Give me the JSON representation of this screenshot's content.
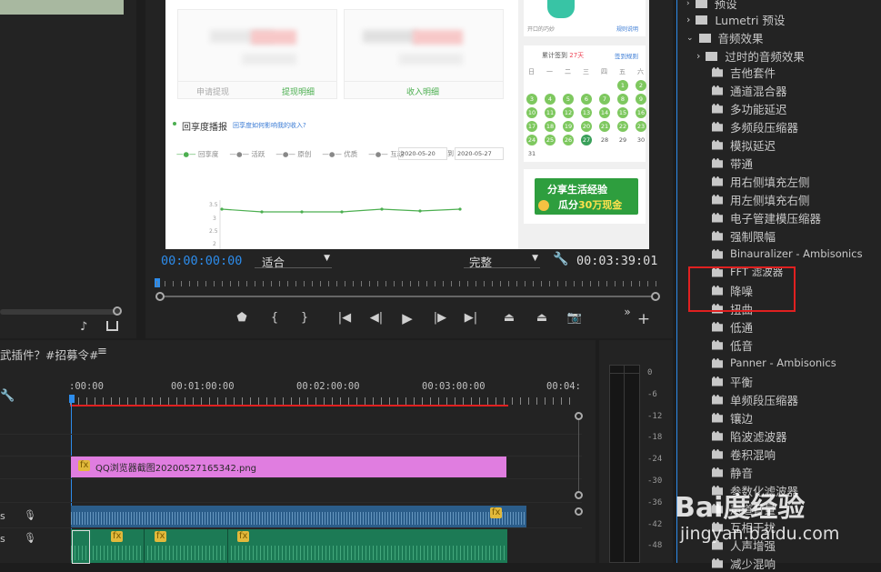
{
  "program": {
    "timecode_current": "00:00:00:00",
    "timecode_total": "00:03:39:01",
    "fit_select": "适合",
    "quality_select": "完整"
  },
  "web_content": {
    "apply_withdraw": "申请提现",
    "withdraw_detail": "提现明细",
    "income_detail": "收入明细",
    "section_title": "回享度播报",
    "section_link": "回享度如何影响我的收入?",
    "legend": [
      "回享度",
      "活跃",
      "原创",
      "优质",
      "互动"
    ],
    "date_from": "2020-05-20",
    "date_to_prefix": "到",
    "date_to": "2020-05-27",
    "y_ticks": [
      "3.5",
      "3",
      "2.5",
      "2"
    ],
    "signin_prefix": "累计签到",
    "signin_days": "27天",
    "signin_rule": "签到规则",
    "weekdays": [
      "日",
      "一",
      "二",
      "三",
      "四",
      "五",
      "六"
    ],
    "cal_rows": [
      [
        "",
        "",
        "",
        "",
        "",
        "1",
        "2"
      ],
      [
        "3",
        "4",
        "5",
        "6",
        "7",
        "8",
        "9"
      ],
      [
        "10",
        "11",
        "12",
        "13",
        "14",
        "15",
        "16"
      ],
      [
        "17",
        "18",
        "19",
        "20",
        "21",
        "22",
        "23"
      ],
      [
        "24",
        "25",
        "26",
        "27",
        "28",
        "29",
        "30"
      ],
      [
        "31",
        "",
        "",
        "",
        "",
        "",
        ""
      ]
    ],
    "ad_line1": "分享生活经验",
    "ad_line2_a": "瓜分",
    "ad_line2_b": "30万现金",
    "top_left_small": "开口的巧妙",
    "top_right_small": "规则说明"
  },
  "timeline": {
    "sequence_name": "武插件？#招募令#",
    "ruler_labels": [
      ":00:00",
      "00:01:00:00",
      "00:02:00:00",
      "00:03:00:00",
      "00:04:"
    ],
    "image_clip": "QQ浏览器截图20200527165342.png",
    "track_label_a1": "s",
    "track_label_a2": "s"
  },
  "meter": {
    "labels": [
      "0",
      "-6",
      "-12",
      "-18",
      "-24",
      "-30",
      "-36",
      "-42",
      "-48"
    ]
  },
  "effects": {
    "top_items": [
      {
        "label": "预设"
      },
      {
        "label": "Lumetri 预设"
      }
    ],
    "audio_folder": "音频效果",
    "obsolete_folder": "过时的音频效果",
    "items": [
      "吉他套件",
      "通道混合器",
      "多功能延迟",
      "多频段压缩器",
      "模拟延迟",
      "带通",
      "用右侧填充左侧",
      "用左侧填充右侧",
      "电子管建模压缩器",
      "强制限幅",
      "Binauralizer - Ambisonics",
      "FFT 滤波器",
      "降噪",
      "扭曲",
      "低通",
      "低音",
      "Panner - Ambisonics",
      "平衡",
      "单频段压缩器",
      "镶边",
      "陷波滤波器",
      "卷积混响",
      "静音",
      "参数化滤波器",
      "声道音量",
      "互相干扰",
      "人声增强",
      "减少混响"
    ]
  },
  "watermark": {
    "brand": "Bai度经验",
    "url": "jingyan.baidu.com"
  },
  "colors": {
    "accent_blue": "#2d8ceb",
    "clip_pink": "#e07de0",
    "audio_green": "#1c7a55",
    "highlight_red": "#e02020"
  }
}
